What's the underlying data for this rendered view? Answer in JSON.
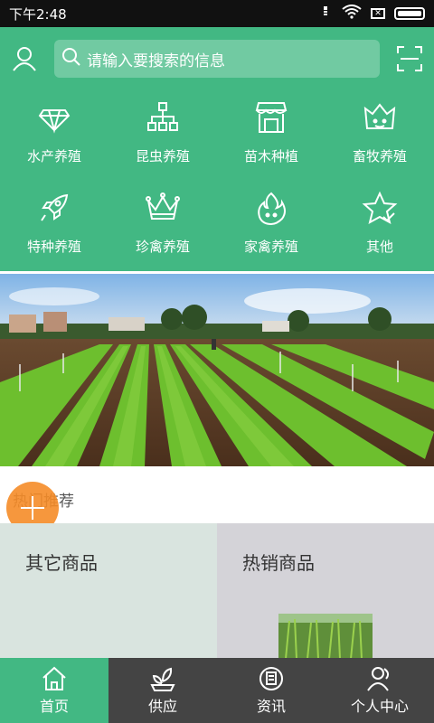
{
  "status_bar": {
    "time": "下午2:48",
    "sim": "✕"
  },
  "search": {
    "placeholder": "请输入要搜索的信息"
  },
  "categories": [
    {
      "label": "水产养殖",
      "icon": "diamond-icon"
    },
    {
      "label": "昆虫养殖",
      "icon": "network-icon"
    },
    {
      "label": "苗木种植",
      "icon": "shop-icon"
    },
    {
      "label": "畜牧养殖",
      "icon": "crown-face-icon"
    },
    {
      "label": "特种养殖",
      "icon": "rocket-icon"
    },
    {
      "label": "珍禽养殖",
      "icon": "crown-icon"
    },
    {
      "label": "家禽养殖",
      "icon": "flame-icon"
    },
    {
      "label": "其他",
      "icon": "star-icon"
    }
  ],
  "section": {
    "title": "热门推荐"
  },
  "cards": [
    {
      "title": "其它商品"
    },
    {
      "title": "热销商品"
    }
  ],
  "tabs": [
    {
      "label": "首页",
      "icon": "home-icon",
      "active": true
    },
    {
      "label": "供应",
      "icon": "sprout-icon",
      "active": false
    },
    {
      "label": "资讯",
      "icon": "news-icon",
      "active": false
    },
    {
      "label": "个人中心",
      "icon": "person-icon",
      "active": false
    }
  ],
  "colors": {
    "brand": "#42b883",
    "tabbar": "#444444",
    "fab": "#f58c28"
  }
}
